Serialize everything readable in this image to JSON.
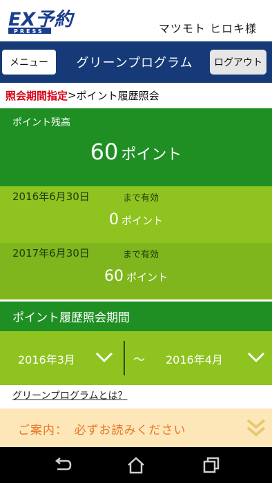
{
  "header": {
    "logo_text": "EX予約",
    "logo_sub": "PRESS",
    "user_name": "マツモト ヒロキ様"
  },
  "nav": {
    "menu_label": "メニュー",
    "title": "グリーンプログラム",
    "logout_label": "ログアウト"
  },
  "breadcrumb": {
    "link": "照会期間指定",
    "separator": ">",
    "current": "ポイント履歴照会"
  },
  "balance": {
    "label": "ポイント残高",
    "points": "60",
    "unit": "ポイント"
  },
  "expirations": [
    {
      "date": "2016年6月30日",
      "note": "まで有効",
      "points": "0",
      "unit": "ポイント"
    },
    {
      "date": "2017年6月30日",
      "note": "まで有効",
      "points": "60",
      "unit": "ポイント"
    }
  ],
  "period": {
    "heading": "ポイント履歴照会期間",
    "from": "2016年3月",
    "separator": "～",
    "to": "2016年4月"
  },
  "about_link": "グリーンプログラムとは？",
  "notice": {
    "text": "ご案内：　必ずお読みください"
  },
  "colors": {
    "nav_blue": "#163a78",
    "dark_green": "#1f8f23",
    "light_green": "#8fc320",
    "accent_red": "#d70015",
    "notice_bg": "#fde7b8",
    "notice_text": "#e8782c"
  },
  "icons": {
    "period_from": "chevron-down-icon",
    "period_to": "chevron-down-icon",
    "notice": "double-chevron-down-icon",
    "system_nav": [
      "back-icon",
      "home-icon",
      "recent-apps-icon"
    ]
  }
}
